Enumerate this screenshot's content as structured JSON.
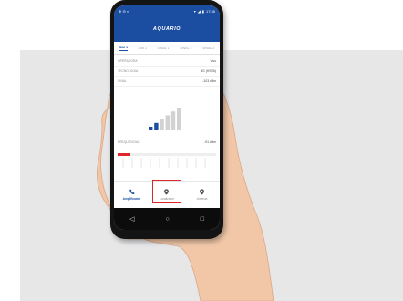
{
  "status_bar": {
    "left_icons": "⊕ ⊖ ∞",
    "time": "17:35"
  },
  "app": {
    "logo": "AQUÁRIO"
  },
  "tabs": [
    {
      "label": "SIM 1",
      "active": true
    },
    {
      "label": "SIM 2",
      "active": false
    },
    {
      "label": "SINAL 1",
      "active": false
    },
    {
      "label": "SINAL 2",
      "active": false
    },
    {
      "label": "SINAL 3",
      "active": false
    }
  ],
  "rows": [
    {
      "label": "OPERADORA",
      "value": "Vivo"
    },
    {
      "label": "TECNOLOGIA",
      "value": "3G (HSPA)"
    },
    {
      "label": "SINAL",
      "value": "-103 dBm"
    }
  ],
  "signal_section": {
    "label": "FREQUÊNCIAS",
    "value": "-91 dBm"
  },
  "signal_level": 0.33,
  "bottom_nav": [
    {
      "label": "Amplificador",
      "icon": "phone-icon",
      "active": true
    },
    {
      "label": "Localizador",
      "icon": "location-pin-icon",
      "active": false
    },
    {
      "label": "Antenas",
      "icon": "location-pin-icon",
      "active": false
    }
  ],
  "system_nav": {
    "back": "◁",
    "home": "○",
    "recents": "□"
  },
  "colors": {
    "brand_blue": "#1b4ea0",
    "highlight_red": "#e0262b",
    "skin": "#f1c7a8",
    "backdrop": "#e7e7e8"
  }
}
